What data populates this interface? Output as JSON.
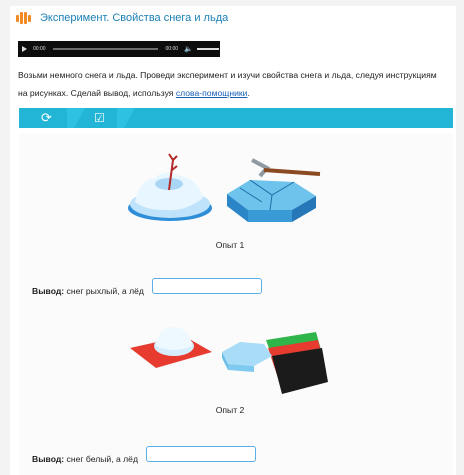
{
  "header": {
    "title": "Эксперимент. Свойства снега и льда",
    "logo_icon": "audio-wave-icon",
    "accent": "#f08a24"
  },
  "audio": {
    "time_current": "00:00",
    "time_total": "00:00",
    "play_icon": "play-icon",
    "volume_icon": "volume-icon"
  },
  "instruction": {
    "text": "Возьми немного снега и льда. Проведи эксперимент и изучи свойства снега и льда, следуя инструкциям на рисунках. Сделай вывод, используя ",
    "link": "слова-помощники",
    "end": "."
  },
  "toolbar": {
    "color": "#22b5d6",
    "refresh_icon": "refresh-icon",
    "check_icon": "checkbox-icon"
  },
  "experiments": [
    {
      "caption": "Опыт 1",
      "conclusion_label": "Вывод:",
      "conclusion_text": " снег рыхлый, а лёд",
      "answer_value": ""
    },
    {
      "caption": "Опыт 2",
      "conclusion_label": "Вывод:",
      "conclusion_text": " снег белый, а лёд",
      "answer_value": ""
    }
  ]
}
